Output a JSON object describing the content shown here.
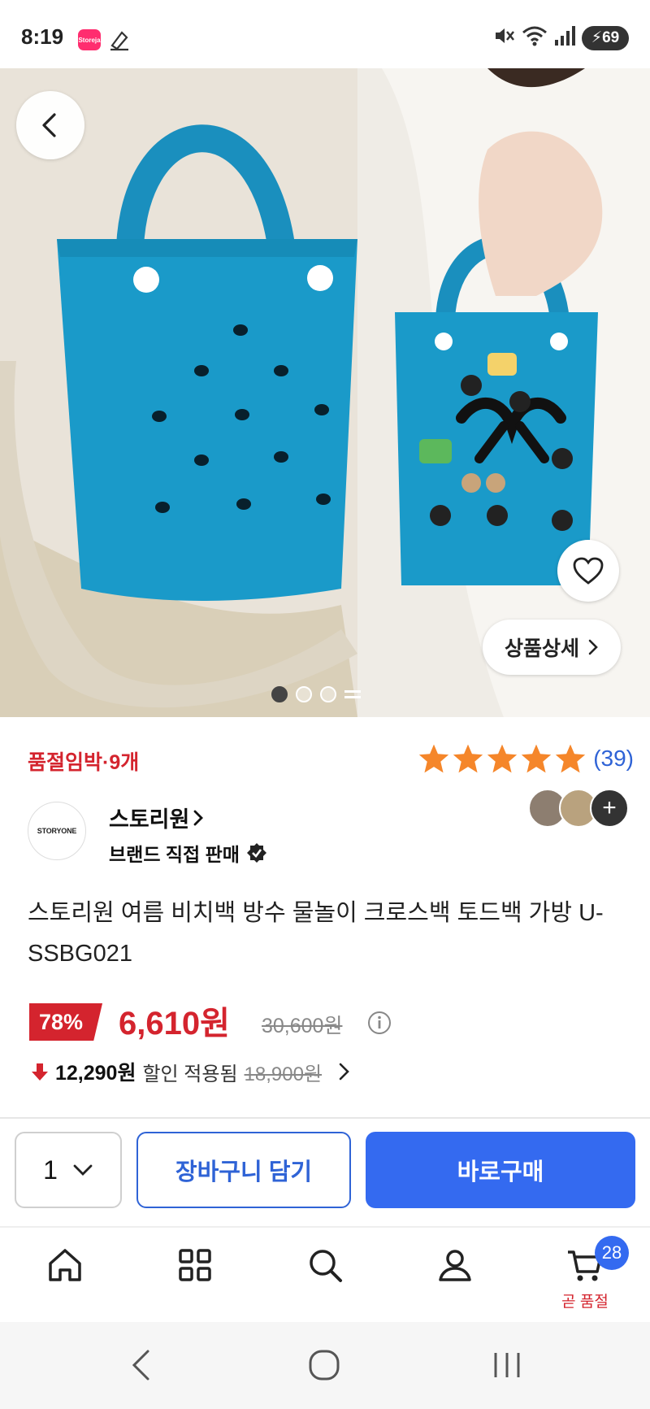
{
  "status_bar": {
    "time": "8:19",
    "app_icon_text": "Storeja",
    "battery": "69"
  },
  "hero": {
    "image_desc": "teal beach tote bags photo",
    "detail_button_label": "상품상세",
    "carousel_total": 3,
    "carousel_active": 1
  },
  "product": {
    "soldout_text": "품절임박·9개",
    "rating_stars": 5,
    "review_count": "(39)",
    "seller_logo_text": "STORYONE",
    "seller_name": "스토리원",
    "seller_sub": "브랜드 직접 판매",
    "title": "스토리원 여름 비치백 방수 물놀이 크로스백 토드백 가방 U-SSBG021",
    "discount": "78%",
    "price": "6,610원",
    "original_price": "30,600원",
    "coupon_price": "12,290원",
    "coupon_label": "할인 적용됨",
    "coupon_original": "18,900원"
  },
  "buy_bar": {
    "quantity": "1",
    "cart_button": "장바구니 담기",
    "buy_button": "바로구매"
  },
  "bottom_nav": {
    "cart_count": "28",
    "cart_label": "곧 품절"
  },
  "colors": {
    "accent_red": "#d4242e",
    "accent_blue": "#346af0",
    "bag_teal": "#1a9ac9",
    "star_orange": "#f5862a"
  }
}
